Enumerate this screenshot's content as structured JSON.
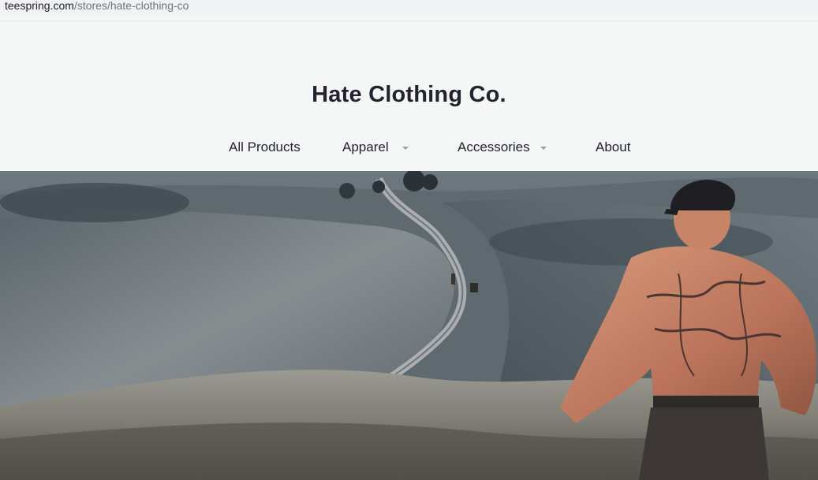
{
  "browser": {
    "url_host": "teespring.com",
    "url_path": "/stores/hate-clothing-co"
  },
  "store": {
    "title": "Hate Clothing Co."
  },
  "nav": {
    "items": [
      {
        "label": "All Products",
        "has_dropdown": false
      },
      {
        "label": "Apparel",
        "has_dropdown": true
      },
      {
        "label": "Accessories",
        "has_dropdown": true
      },
      {
        "label": "About",
        "has_dropdown": false
      }
    ]
  },
  "hero": {
    "description_icon": "landscape-banner-image",
    "colors": {
      "sky": "#5d6a74",
      "field_dark": "#3f4a52",
      "field_light": "#8f979b",
      "road": "#b9bcbc",
      "skin": "#c9866c"
    }
  }
}
